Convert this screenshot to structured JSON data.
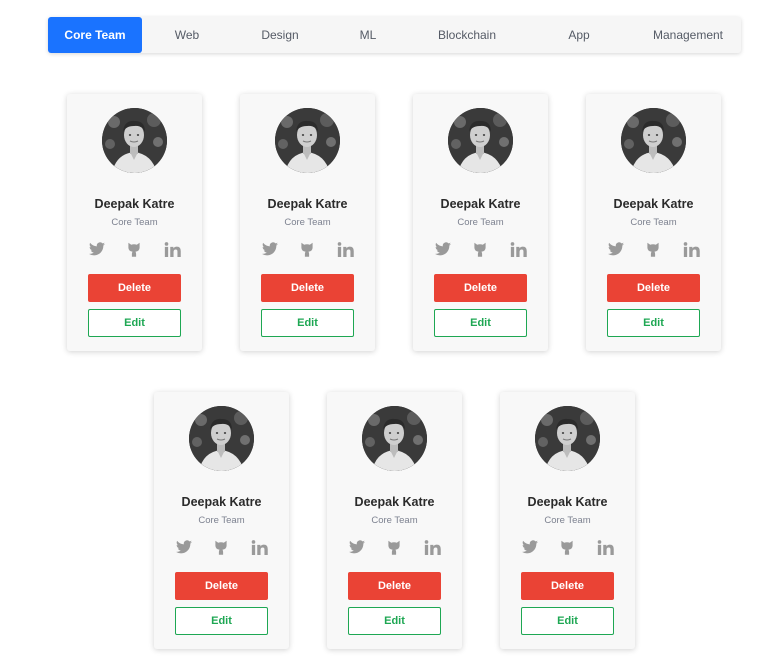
{
  "tabs": [
    {
      "label": "Core Team",
      "active": true
    },
    {
      "label": "Web",
      "active": false
    },
    {
      "label": "Design",
      "active": false
    },
    {
      "label": "ML",
      "active": false
    },
    {
      "label": "Blockchain",
      "active": false
    },
    {
      "label": "App",
      "active": false
    },
    {
      "label": "Management",
      "active": false
    }
  ],
  "colors": {
    "active_tab": "#1a73ff",
    "delete": "#ea4335",
    "edit": "#1ea753",
    "icon": "#9a9a9a"
  },
  "icons": [
    "twitter-icon",
    "github-icon",
    "linkedin-icon"
  ],
  "cards": [
    {
      "name": "Deepak Katre",
      "role": "Core Team",
      "delete_label": "Delete",
      "edit_label": "Edit"
    },
    {
      "name": "Deepak Katre",
      "role": "Core Team",
      "delete_label": "Delete",
      "edit_label": "Edit"
    },
    {
      "name": "Deepak Katre",
      "role": "Core Team",
      "delete_label": "Delete",
      "edit_label": "Edit"
    },
    {
      "name": "Deepak Katre",
      "role": "Core Team",
      "delete_label": "Delete",
      "edit_label": "Edit"
    },
    {
      "name": "Deepak Katre",
      "role": "Core Team",
      "delete_label": "Delete",
      "edit_label": "Edit"
    },
    {
      "name": "Deepak Katre",
      "role": "Core Team",
      "delete_label": "Delete",
      "edit_label": "Edit"
    },
    {
      "name": "Deepak Katre",
      "role": "Core Team",
      "delete_label": "Delete",
      "edit_label": "Edit"
    }
  ]
}
